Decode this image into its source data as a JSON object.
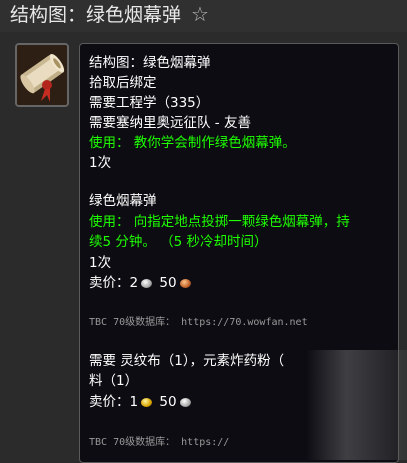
{
  "header": {
    "title": "结构图：绿色烟幕弹",
    "favorite_icon": "star-outline-icon"
  },
  "item_icon": "scroll-recipe-icon",
  "tooltip": {
    "name": "结构图：绿色烟幕弹",
    "binding": "拾取后绑定",
    "requires_skill": "需要工程学（335）",
    "requires_rep": "需要塞纳里奥远征队 - 友善",
    "use_text": "使用：  教你学会制作绿色烟幕弹。",
    "charges": "1次",
    "created_item": {
      "name": "绿色烟幕弹",
      "use_line1": "使用：  向指定地点投掷一颗绿色烟幕弹，持",
      "use_line2": "续5 分钟。 （5 秒冷却时间）",
      "charges": "1次",
      "sell_label": "卖价：",
      "sell_silver": "2",
      "sell_copper": "50"
    },
    "db_label_1": "TBC 70级数据库：",
    "db_link_1": "https://70.wowfan.net",
    "reagents_line1": "需要 灵纹布（1），元素炸药粉（",
    "reagents_line2": "料（1）",
    "sell_label": "卖价：",
    "sell_gold": "1",
    "sell_silver": "50",
    "db_label_2": "TBC 70级数据库：",
    "db_link_2": "https://"
  },
  "colors": {
    "use_text": "#1eff00",
    "tooltip_bg": "#0c0c12",
    "page_bg": "#2b2b2b"
  }
}
